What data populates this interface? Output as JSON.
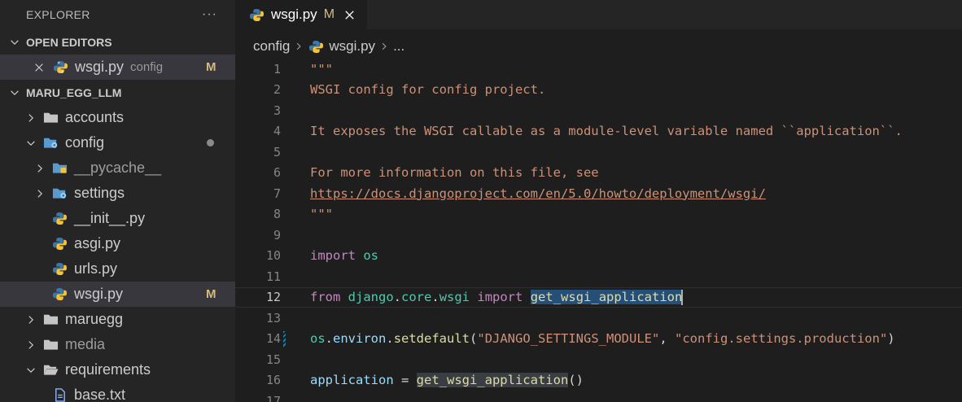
{
  "explorer": {
    "title": "EXPLORER",
    "more_label": "···"
  },
  "open_editors": {
    "title": "OPEN EDITORS",
    "items": [
      {
        "name": "wsgi.py",
        "folder": "config",
        "status": "M"
      }
    ]
  },
  "project": {
    "title": "MARU_EGG_LLM",
    "tree": {
      "accounts": "accounts",
      "config": "config",
      "pycache": "__pycache__",
      "settings": "settings",
      "init": "__init__.py",
      "asgi": "asgi.py",
      "urls": "urls.py",
      "wsgi": "wsgi.py",
      "wsgi_status": "M",
      "maruegg": "maruegg",
      "media": "media",
      "requirements": "requirements",
      "base": "base.txt"
    }
  },
  "tab": {
    "label": "wsgi.py",
    "status": "M"
  },
  "breadcrumbs": {
    "folder": "config",
    "file": "wsgi.py",
    "more": "..."
  },
  "editor": {
    "current_line": 12,
    "line_numbers": [
      "1",
      "2",
      "3",
      "4",
      "5",
      "6",
      "7",
      "8",
      "9",
      "10",
      "11",
      "12",
      "13",
      "14",
      "15",
      "16",
      "17"
    ],
    "code": {
      "l1": "\"\"\"",
      "l2": "WSGI config for config project.",
      "l4": "It exposes the WSGI callable as a module-level variable named ``application``.",
      "l6": "For more information on this file, see",
      "l7": "https://docs.djangoproject.com/en/5.0/howto/deployment/wsgi/",
      "l8": "\"\"\"",
      "l10_kw": "import",
      "l10_mod": "os",
      "l12_from": "from",
      "l12_django": "django",
      "l12_core": "core",
      "l12_wsgi": "wsgi",
      "l12_import": "import",
      "l12_fn": "get_wsgi_application",
      "l14_os": "os",
      "l14_environ": "environ",
      "l14_fn": "setdefault",
      "l14_arg1": "\"DJANGO_SETTINGS_MODULE\"",
      "l14_arg2": "\"config.settings.production\"",
      "l16_var": "application",
      "l16_fn": "get_wsgi_application"
    }
  },
  "colors": {
    "modified": "#d7ba7d",
    "string": "#ce9178",
    "keyword": "#c586c0",
    "module": "#4ec9b0",
    "function": "#dcdcaa",
    "variable": "#9cdcfe",
    "selection": "#264f78"
  },
  "icons": [
    "more-icon",
    "chevron-down-icon",
    "chevron-right-icon",
    "close-icon",
    "python-file-icon",
    "folder-icon",
    "folder-open-icon",
    "config-folder-icon",
    "text-file-icon"
  ]
}
